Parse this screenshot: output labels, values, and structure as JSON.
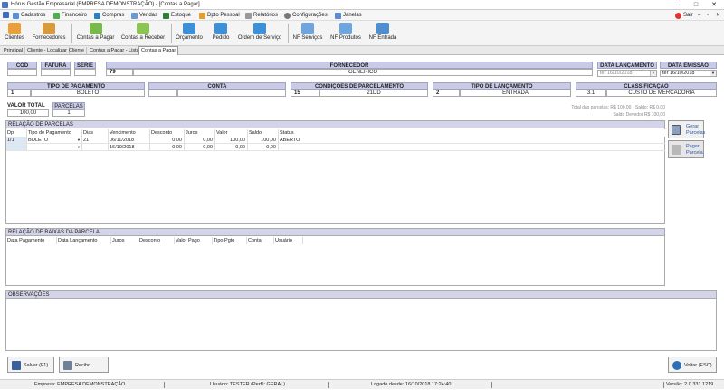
{
  "window": {
    "title": "Hórus Gestão Empresarial (EMPRESA DEMONSTRAÇÃO) - [Contas a Pagar]",
    "minimize": "–",
    "maximize": "□",
    "close": "✕"
  },
  "menu": {
    "items": [
      "Cadastros",
      "Financeiro",
      "Compras",
      "Vendas",
      "Estoque",
      "Dpto Pessoal",
      "Relatórios",
      "Configurações",
      "Janelas"
    ],
    "sair": "Sair"
  },
  "toolbar": {
    "buttons": [
      "Clientes",
      "Fornecedores",
      "Contas a Pagar",
      "Contas a Receber",
      "Orçamento",
      "Pedido",
      "Ordem de Serviço",
      "NF Serviços",
      "NF Produtos",
      "NF Entrada"
    ]
  },
  "tabs": [
    "Principal",
    "Cliente - Localizar",
    "Cliente",
    "Contas a Pagar - Lista",
    "Contas a Pagar"
  ],
  "form": {
    "cod_label": "COD",
    "cod": "",
    "fatura_label": "FATURA",
    "fatura": "",
    "serie_label": "SÉRIE",
    "serie": "",
    "fornecedor_label": "FORNECEDOR",
    "fornecedor_code": "79",
    "fornecedor": "GENERICO",
    "data_lanc_label": "DATA LANÇAMENTO",
    "data_lanc": "ter 16/10/2018",
    "data_emis_label": "DATA EMISSÃO",
    "data_emis": "ter 16/10/2018",
    "tipo_pag_label": "TIPO DE PAGAMENTO",
    "tipo_pag_code": "1",
    "tipo_pag": "BOLETO",
    "conta_label": "CONTA",
    "conta_code": "",
    "conta": "",
    "cond_label": "CONDIÇÕES DE PARCELAMENTO",
    "cond_code": "15",
    "cond": "21DD",
    "tipo_lanc_label": "TIPO DE LANÇAMENTO",
    "tipo_lanc_code": "2",
    "tipo_lanc": "ENTRADA",
    "class_label": "CLASSIFICAÇÃO",
    "class_code": "3.1",
    "class": "CUSTO DE MERCADORIA",
    "valor_total_label": "VALOR TOTAL",
    "valor_total": "100,00",
    "parcelas_label": "PARCELAS",
    "parcelas": "1",
    "total_info": "Total das parcelas: R$ 100,00 - Saldo: R$ 0,00",
    "saldo_info": "Saldo Devedor R$ 100,00"
  },
  "parcelas": {
    "title": "RELAÇÃO DE PARCELAS",
    "columns": [
      "Dp",
      "Tipo de Pagamento",
      "Dias",
      "Vencimento",
      "Desconto",
      "Juros",
      "Valor",
      "Saldo",
      "Status"
    ],
    "rows": [
      [
        "1/1",
        "BOLETO",
        "21",
        "06/11/2018",
        "0,00",
        "0,00",
        "100,00",
        "100,00",
        "ABERTO"
      ],
      [
        "",
        "",
        "",
        "16/10/2018",
        "0,00",
        "0,00",
        "0,00",
        "0,00",
        ""
      ]
    ]
  },
  "baixas": {
    "title": "RELAÇÃO DE BAIXAS DA PARCELA",
    "columns": [
      "Data Pagamento",
      "Data Lançamento",
      "Juros",
      "Desconto",
      "Valor Pago",
      "Tipo Pgto",
      "Conta",
      "Usuário"
    ]
  },
  "obs": {
    "title": "OBSERVAÇÕES"
  },
  "side": {
    "gerar": "Gerar\nParcelas",
    "pagar": "Pagar\nParcela"
  },
  "bottom": {
    "salvar": "Salvar (F1)",
    "recibo": "Recibo",
    "voltar": "Voltar (ESC)"
  },
  "status": {
    "empresa": "Empresa: EMPRESA DEMONSTRAÇÃO",
    "usuario": "Usuário: TESTER (Perfil: GERAL)",
    "logado": "Logado desde: 16/10/2018 17:24:40",
    "versao": "Versão: 2.0.331.1219"
  },
  "colors": {
    "header_bg": "#c9cbe4",
    "section_bg": "#d3d4ea",
    "link": "#2c55a5"
  }
}
